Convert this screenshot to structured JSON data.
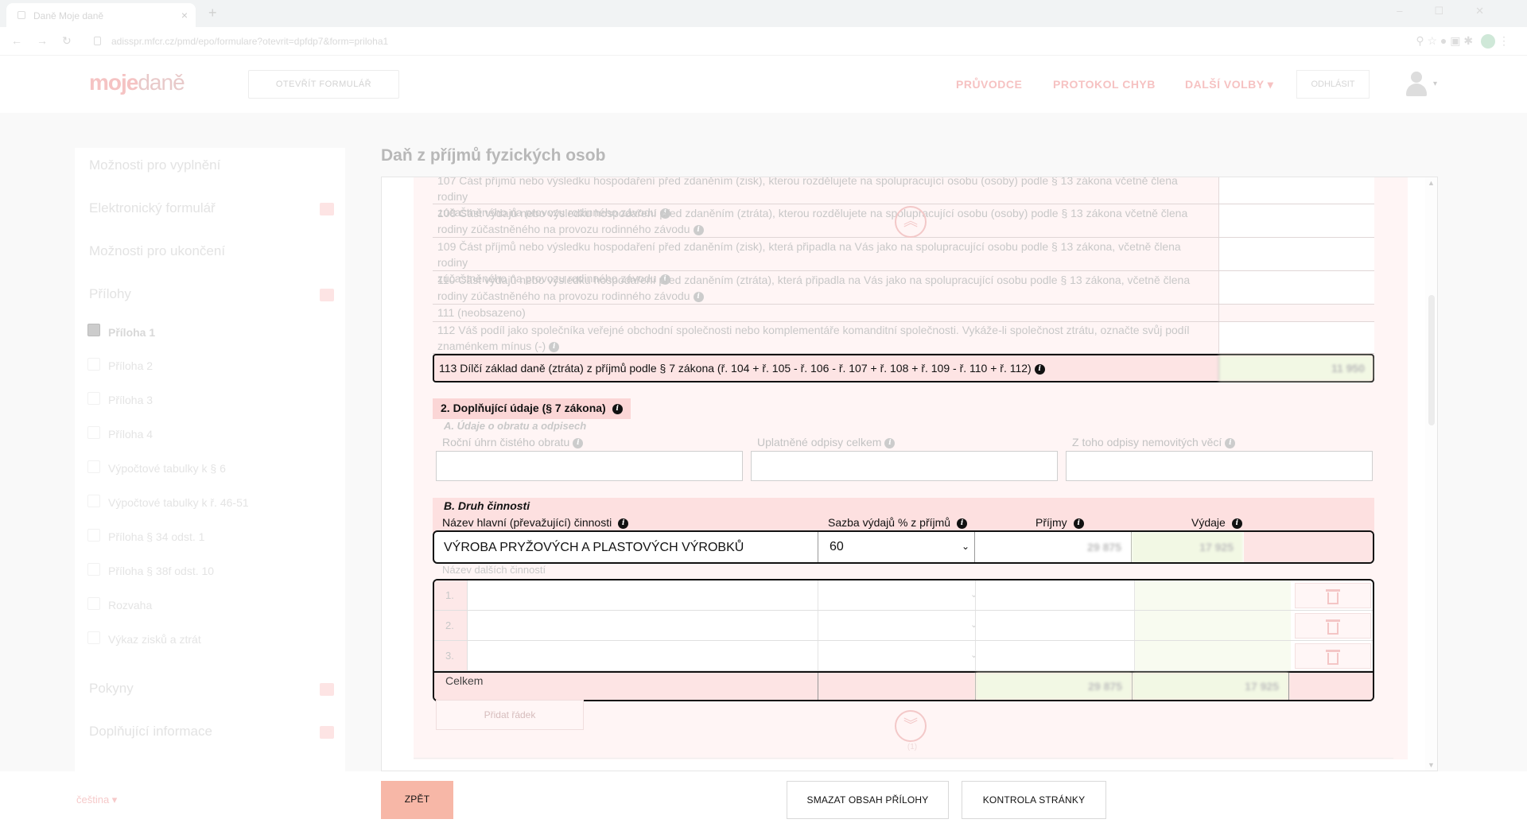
{
  "browser": {
    "tab_title": "Daně Moje daně",
    "url": "adisspr.mfcr.cz/pmd/epo/formulare?otevrit=dpfdp7&form=priloha1"
  },
  "header": {
    "logo_moje": "moje",
    "logo_dane": "daně",
    "open_form": "OTEVŘÍT FORMULÁŘ",
    "nav_items": [
      "PRŮVODCE",
      "PROTOKOL CHYB",
      "DALŠÍ VOLBY ▾"
    ],
    "logout": "ODHLÁSIT"
  },
  "sidebar": {
    "items": [
      "Možnosti pro vyplnění",
      "Elektronický formulář",
      "Možnosti pro ukončení",
      "Přílohy"
    ],
    "sub_items": [
      "Příloha 1",
      "Příloha 2",
      "Příloha 3",
      "Příloha 4",
      "Výpočtové tabulky k § 6",
      "Výpočtové tabulky k ř. 46-51",
      "Příloha § 34 odst. 1",
      "Příloha § 38f odst. 10",
      "Rozvaha",
      "Výkaz zisků a ztrát"
    ],
    "bottom_items": [
      "Pokyny",
      "Doplňující informace"
    ]
  },
  "page": {
    "title": "Daň z příjmů fyzických osob"
  },
  "rows": [
    {
      "l1": "107 Část příjmů nebo výsledku hospodaření před zdaněním (zisk), kterou rozdělujete na spolupracující osobu (osoby) podle § 13 zákona včetně člena rodiny",
      "l2": "zúčastněného na provozu rodinného závodu"
    },
    {
      "l1": "108 Část výdajů nebo výsledku hospodaření před zdaněním (ztráta), kterou rozdělujete na spolupracující osobu (osoby) podle § 13 zákona včetně člena",
      "l2": "rodiny zúčastněného na provozu rodinného závodu"
    },
    {
      "l1": "109 Část příjmů nebo výsledku hospodaření před zdaněním (zisk), která připadla na Vás jako na spolupracující osobu podle § 13 zákona, včetně člena rodiny",
      "l2": "zúčastněného na provozu rodinného závodu"
    },
    {
      "l1": "110 Část výdajů nebo výsledku hospodaření před zdaněním (ztráta), která připadla na Vás jako na spolupracující osobu podle § 13 zákona, včetně člena",
      "l2": "rodiny zúčastněného na provozu rodinného závodu"
    },
    {
      "l1": "111 (neobsazeno)",
      "l2": ""
    },
    {
      "l1": "112 Váš podíl jako společníka veřejné obchodní společnosti nebo komplementáře komanditní společnosti. Vykáže-li společnost ztrátu, označte svůj podíl",
      "l2": "znaménkem mínus (-)"
    }
  ],
  "row113": {
    "label": "113 Dílčí základ daně (ztráta) z příjmů podle § 7 zákona (ř. 104 + ř. 105 - ř. 106 - ř. 107 + ř. 108 + ř. 109 - ř. 110 + ř. 112)",
    "value": "11 950"
  },
  "section2": {
    "title": "2. Doplňující údaje (§ 7 zákona)",
    "subA": "A. Údaje o obratu a odpisech",
    "fields": [
      "Roční úhrn čistého obratu",
      "Uplatněné odpisy celkem",
      "Z toho odpisy nemovitých věcí"
    ],
    "subB": "B. Druh činnosti",
    "cols": [
      "Název hlavní (převažující) činnosti",
      "Sazba výdajů % z příjmů",
      "Příjmy",
      "Výdaje"
    ]
  },
  "main_activity": {
    "name": "VÝROBA PRYŽOVÝCH A PLASTOVÝCH VÝROBKŮ",
    "rate": "60",
    "income": "29 875",
    "expenses": "17 925"
  },
  "other": {
    "label": "Název dalších činností",
    "rows": [
      "1.",
      "2.",
      "3."
    ],
    "total_label": "Celkem",
    "total_income": "29 875",
    "total_expenses": "17 925",
    "add_row": "Přidat řádek"
  },
  "nav_counter": "(1)",
  "footer": {
    "lang": "čeština ▾",
    "back": "ZPĚT",
    "clear": "SMAZAT OBSAH PŘÍLOHY",
    "check": "KONTROLA STRÁNKY"
  }
}
